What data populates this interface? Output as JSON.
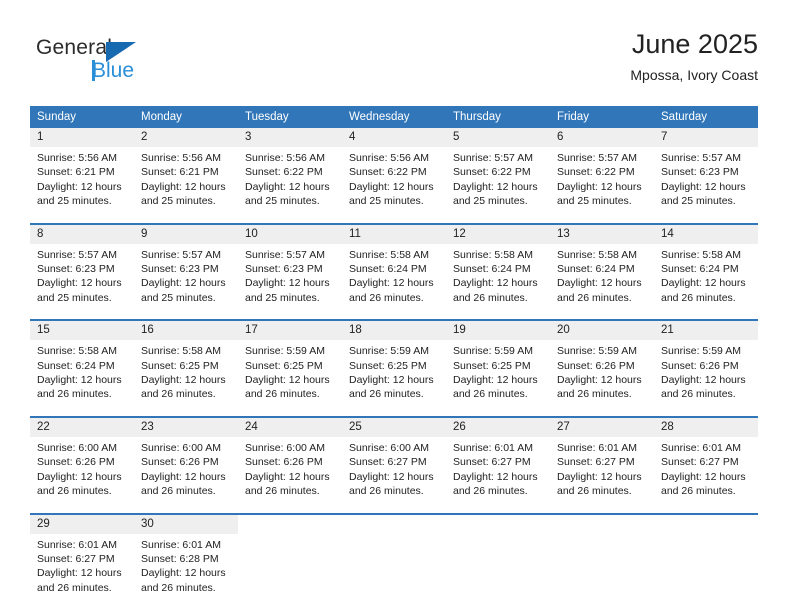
{
  "logo": {
    "word_one": "General",
    "word_two": "Blue",
    "triangle_color": "#1769b0",
    "blue_color": "#2a8fd8"
  },
  "header": {
    "title": "June 2025",
    "location": "Mpossa, Ivory Coast"
  },
  "calendar": {
    "header_bg": "#3176b8",
    "daynum_bg": "#efefef",
    "weekday_headers": [
      "Sunday",
      "Monday",
      "Tuesday",
      "Wednesday",
      "Thursday",
      "Friday",
      "Saturday"
    ],
    "weeks": [
      [
        {
          "day": "1",
          "sunrise": "Sunrise: 5:56 AM",
          "sunset": "Sunset: 6:21 PM",
          "daylight_1": "Daylight: 12 hours",
          "daylight_2": "and 25 minutes."
        },
        {
          "day": "2",
          "sunrise": "Sunrise: 5:56 AM",
          "sunset": "Sunset: 6:21 PM",
          "daylight_1": "Daylight: 12 hours",
          "daylight_2": "and 25 minutes."
        },
        {
          "day": "3",
          "sunrise": "Sunrise: 5:56 AM",
          "sunset": "Sunset: 6:22 PM",
          "daylight_1": "Daylight: 12 hours",
          "daylight_2": "and 25 minutes."
        },
        {
          "day": "4",
          "sunrise": "Sunrise: 5:56 AM",
          "sunset": "Sunset: 6:22 PM",
          "daylight_1": "Daylight: 12 hours",
          "daylight_2": "and 25 minutes."
        },
        {
          "day": "5",
          "sunrise": "Sunrise: 5:57 AM",
          "sunset": "Sunset: 6:22 PM",
          "daylight_1": "Daylight: 12 hours",
          "daylight_2": "and 25 minutes."
        },
        {
          "day": "6",
          "sunrise": "Sunrise: 5:57 AM",
          "sunset": "Sunset: 6:22 PM",
          "daylight_1": "Daylight: 12 hours",
          "daylight_2": "and 25 minutes."
        },
        {
          "day": "7",
          "sunrise": "Sunrise: 5:57 AM",
          "sunset": "Sunset: 6:23 PM",
          "daylight_1": "Daylight: 12 hours",
          "daylight_2": "and 25 minutes."
        }
      ],
      [
        {
          "day": "8",
          "sunrise": "Sunrise: 5:57 AM",
          "sunset": "Sunset: 6:23 PM",
          "daylight_1": "Daylight: 12 hours",
          "daylight_2": "and 25 minutes."
        },
        {
          "day": "9",
          "sunrise": "Sunrise: 5:57 AM",
          "sunset": "Sunset: 6:23 PM",
          "daylight_1": "Daylight: 12 hours",
          "daylight_2": "and 25 minutes."
        },
        {
          "day": "10",
          "sunrise": "Sunrise: 5:57 AM",
          "sunset": "Sunset: 6:23 PM",
          "daylight_1": "Daylight: 12 hours",
          "daylight_2": "and 25 minutes."
        },
        {
          "day": "11",
          "sunrise": "Sunrise: 5:58 AM",
          "sunset": "Sunset: 6:24 PM",
          "daylight_1": "Daylight: 12 hours",
          "daylight_2": "and 26 minutes."
        },
        {
          "day": "12",
          "sunrise": "Sunrise: 5:58 AM",
          "sunset": "Sunset: 6:24 PM",
          "daylight_1": "Daylight: 12 hours",
          "daylight_2": "and 26 minutes."
        },
        {
          "day": "13",
          "sunrise": "Sunrise: 5:58 AM",
          "sunset": "Sunset: 6:24 PM",
          "daylight_1": "Daylight: 12 hours",
          "daylight_2": "and 26 minutes."
        },
        {
          "day": "14",
          "sunrise": "Sunrise: 5:58 AM",
          "sunset": "Sunset: 6:24 PM",
          "daylight_1": "Daylight: 12 hours",
          "daylight_2": "and 26 minutes."
        }
      ],
      [
        {
          "day": "15",
          "sunrise": "Sunrise: 5:58 AM",
          "sunset": "Sunset: 6:24 PM",
          "daylight_1": "Daylight: 12 hours",
          "daylight_2": "and 26 minutes."
        },
        {
          "day": "16",
          "sunrise": "Sunrise: 5:58 AM",
          "sunset": "Sunset: 6:25 PM",
          "daylight_1": "Daylight: 12 hours",
          "daylight_2": "and 26 minutes."
        },
        {
          "day": "17",
          "sunrise": "Sunrise: 5:59 AM",
          "sunset": "Sunset: 6:25 PM",
          "daylight_1": "Daylight: 12 hours",
          "daylight_2": "and 26 minutes."
        },
        {
          "day": "18",
          "sunrise": "Sunrise: 5:59 AM",
          "sunset": "Sunset: 6:25 PM",
          "daylight_1": "Daylight: 12 hours",
          "daylight_2": "and 26 minutes."
        },
        {
          "day": "19",
          "sunrise": "Sunrise: 5:59 AM",
          "sunset": "Sunset: 6:25 PM",
          "daylight_1": "Daylight: 12 hours",
          "daylight_2": "and 26 minutes."
        },
        {
          "day": "20",
          "sunrise": "Sunrise: 5:59 AM",
          "sunset": "Sunset: 6:26 PM",
          "daylight_1": "Daylight: 12 hours",
          "daylight_2": "and 26 minutes."
        },
        {
          "day": "21",
          "sunrise": "Sunrise: 5:59 AM",
          "sunset": "Sunset: 6:26 PM",
          "daylight_1": "Daylight: 12 hours",
          "daylight_2": "and 26 minutes."
        }
      ],
      [
        {
          "day": "22",
          "sunrise": "Sunrise: 6:00 AM",
          "sunset": "Sunset: 6:26 PM",
          "daylight_1": "Daylight: 12 hours",
          "daylight_2": "and 26 minutes."
        },
        {
          "day": "23",
          "sunrise": "Sunrise: 6:00 AM",
          "sunset": "Sunset: 6:26 PM",
          "daylight_1": "Daylight: 12 hours",
          "daylight_2": "and 26 minutes."
        },
        {
          "day": "24",
          "sunrise": "Sunrise: 6:00 AM",
          "sunset": "Sunset: 6:26 PM",
          "daylight_1": "Daylight: 12 hours",
          "daylight_2": "and 26 minutes."
        },
        {
          "day": "25",
          "sunrise": "Sunrise: 6:00 AM",
          "sunset": "Sunset: 6:27 PM",
          "daylight_1": "Daylight: 12 hours",
          "daylight_2": "and 26 minutes."
        },
        {
          "day": "26",
          "sunrise": "Sunrise: 6:01 AM",
          "sunset": "Sunset: 6:27 PM",
          "daylight_1": "Daylight: 12 hours",
          "daylight_2": "and 26 minutes."
        },
        {
          "day": "27",
          "sunrise": "Sunrise: 6:01 AM",
          "sunset": "Sunset: 6:27 PM",
          "daylight_1": "Daylight: 12 hours",
          "daylight_2": "and 26 minutes."
        },
        {
          "day": "28",
          "sunrise": "Sunrise: 6:01 AM",
          "sunset": "Sunset: 6:27 PM",
          "daylight_1": "Daylight: 12 hours",
          "daylight_2": "and 26 minutes."
        }
      ],
      [
        {
          "day": "29",
          "sunrise": "Sunrise: 6:01 AM",
          "sunset": "Sunset: 6:27 PM",
          "daylight_1": "Daylight: 12 hours",
          "daylight_2": "and 26 minutes."
        },
        {
          "day": "30",
          "sunrise": "Sunrise: 6:01 AM",
          "sunset": "Sunset: 6:28 PM",
          "daylight_1": "Daylight: 12 hours",
          "daylight_2": "and 26 minutes."
        },
        {
          "day": "",
          "sunrise": "",
          "sunset": "",
          "daylight_1": "",
          "daylight_2": ""
        },
        {
          "day": "",
          "sunrise": "",
          "sunset": "",
          "daylight_1": "",
          "daylight_2": ""
        },
        {
          "day": "",
          "sunrise": "",
          "sunset": "",
          "daylight_1": "",
          "daylight_2": ""
        },
        {
          "day": "",
          "sunrise": "",
          "sunset": "",
          "daylight_1": "",
          "daylight_2": ""
        },
        {
          "day": "",
          "sunrise": "",
          "sunset": "",
          "daylight_1": "",
          "daylight_2": ""
        }
      ]
    ]
  }
}
